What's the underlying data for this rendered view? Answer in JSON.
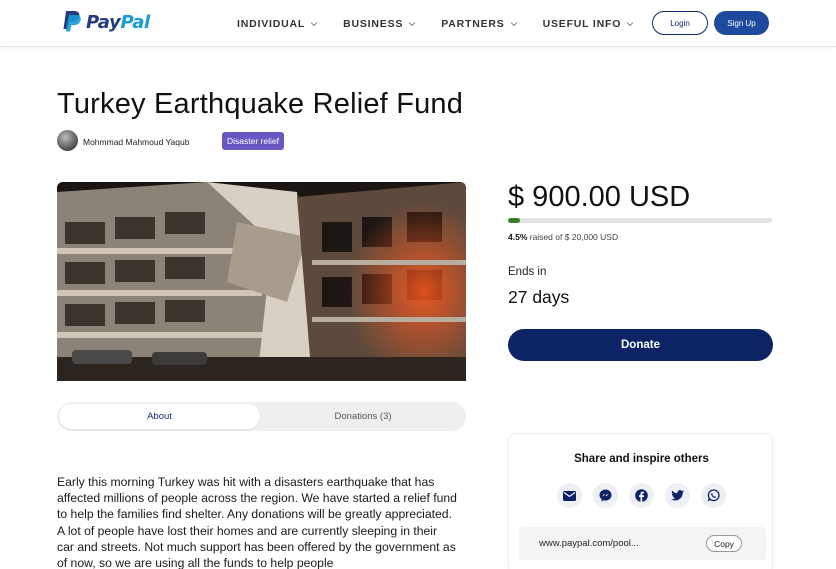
{
  "header": {
    "logo_text_1": "Pay",
    "logo_text_2": "Pal",
    "nav": [
      {
        "label": "INDIVIDUAL"
      },
      {
        "label": "BUSINESS"
      },
      {
        "label": "PARTNERS"
      },
      {
        "label": "USEFUL INFO"
      }
    ],
    "login_label": "Login",
    "signup_label": "Sign Up"
  },
  "fundraiser": {
    "title": "Turkey Earthquake Relief Fund",
    "author": "Mohmmad Mahmoud Yaqub",
    "category_badge": "Disaster relief",
    "image_icon": "earthquake-photo"
  },
  "tabs": {
    "about": "About",
    "donations": "Donations (3)"
  },
  "description": "Early this morning Turkey was hit with a disasters earthquake that has affected millions of people across the region. We have started a relief fund to help the families find shelter. Any donations will be greatly appreciated. A lot of people have lost their homes and are currently sleeping in their car and streets. Not much support has been offered by the government as of now, so we are using all the funds to help people",
  "donation": {
    "amount": "$ 900.00 USD",
    "percent": "4.5%",
    "progress_fraction": 0.045,
    "raised_text": " raised of $ 20,000 USD",
    "ends_label": "Ends in",
    "ends_value": "27 days",
    "donate_label": "Donate"
  },
  "share": {
    "title": "Share and inspire others",
    "icons": [
      "email-icon",
      "messenger-icon",
      "facebook-icon",
      "twitter-icon",
      "whatsapp-icon"
    ],
    "link": "www.paypal.com/pool...",
    "copy_label": "Copy"
  },
  "colors": {
    "brand_dark": "#0c2466",
    "brand_blue": "#1e4a9e",
    "badge": "#6b57c2",
    "progress": "#3c7d2a"
  }
}
